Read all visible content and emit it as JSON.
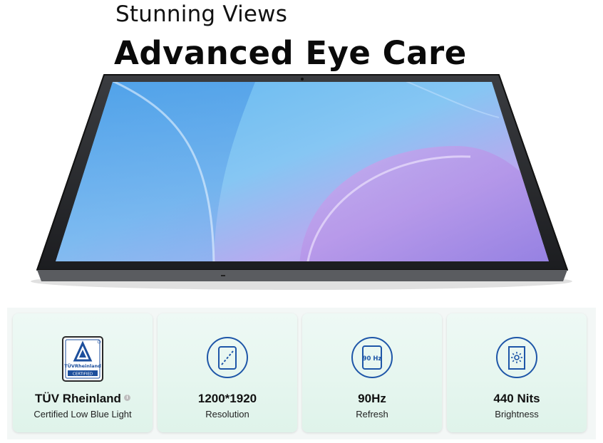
{
  "hero": {
    "subtitle": "Stunning Views",
    "title": "Advanced Eye Care"
  },
  "features": [
    {
      "value": "TÜV Rheinland",
      "label": "Certified Low Blue Light",
      "icon": "tuv-rheinland-logo",
      "logo_text_1": "TÜVRheinland",
      "logo_text_2": "CERTIFIED"
    },
    {
      "value": "1200*1920",
      "label": "Resolution",
      "icon": "tablet-diagonal-icon"
    },
    {
      "value": "90Hz",
      "label": "Refresh",
      "icon": "refresh-rate-icon",
      "icon_text": "90 Hz"
    },
    {
      "value": "440 Nits",
      "label": "Brightness",
      "icon": "brightness-icon"
    }
  ],
  "colors": {
    "accent": "#1e56a8",
    "card_bg": "#e4f5ee",
    "tablet_frame": "#2b2d31"
  }
}
